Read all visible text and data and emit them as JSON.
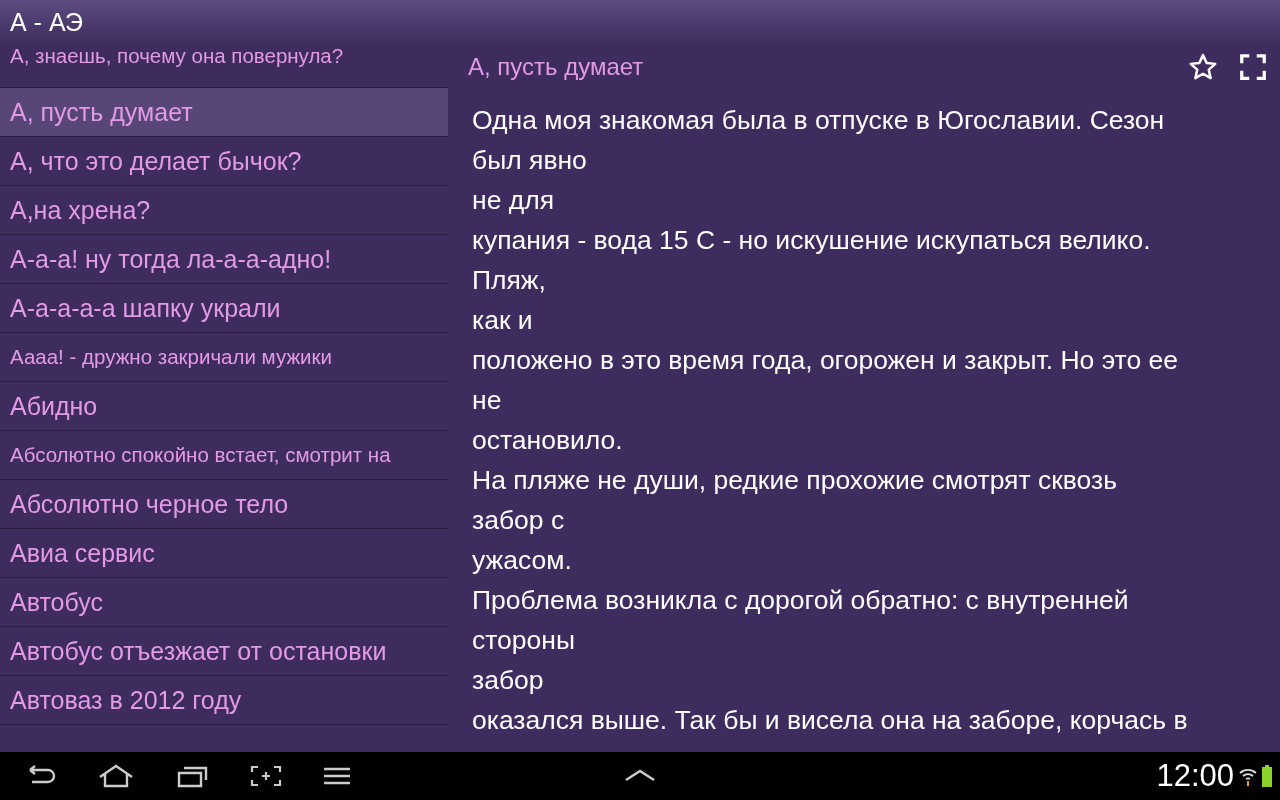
{
  "window": {
    "title": "А - АЭ"
  },
  "list": {
    "items": [
      {
        "text": "А, знаешь, почему она повернула?",
        "kind": "small",
        "selected": false
      },
      {
        "text": "А, пусть думает",
        "kind": "normal",
        "selected": true
      },
      {
        "text": "А, что это делает бычок?",
        "kind": "normal",
        "selected": false
      },
      {
        "text": "А,на хрена?",
        "kind": "normal",
        "selected": false
      },
      {
        "text": "А-а-а! ну тогда ла-а-а-адно!",
        "kind": "normal",
        "selected": false
      },
      {
        "text": "А-а-а-а-а шапку украли",
        "kind": "normal",
        "selected": false
      },
      {
        "text": "Аааа! - дружно закричали мужики",
        "kind": "small",
        "selected": false
      },
      {
        "text": "Абидно",
        "kind": "normal",
        "selected": false
      },
      {
        "text": "Абсолютно спокойно встает, смотрит на",
        "kind": "small",
        "selected": false
      },
      {
        "text": "Абсолютно черное тело",
        "kind": "normal",
        "selected": false
      },
      {
        "text": "Авиа сервис",
        "kind": "normal",
        "selected": false
      },
      {
        "text": "Автобус",
        "kind": "normal",
        "selected": false
      },
      {
        "text": "Автобус отъезжает от остановки",
        "kind": "normal",
        "selected": false
      },
      {
        "text": "Автоваз в 2012 году",
        "kind": "normal",
        "selected": false
      }
    ]
  },
  "detail": {
    "title": "А, пусть думает",
    "favorite": false,
    "lines": [
      "Одна моя знакомая была в отпуске в Югославии. Сезон",
      "был явно",
      "не для",
      "купания - вода 15 С - но искушение искупаться велико.",
      "Пляж,",
      "как и",
      "положено в это время года, огорожен и закрыт. Но это ее",
      "не",
      "остановило.",
      "На пляже не души, редкие прохожие смотрят сквозь",
      "забор с",
      "ужасом.",
      "Проблема возникла с дорогой обратно: с внутренней",
      "стороны",
      "забор",
      "оказался выше. Так бы и висела она на заборе, корчась в"
    ]
  },
  "status_bar": {
    "time": "12:00"
  }
}
